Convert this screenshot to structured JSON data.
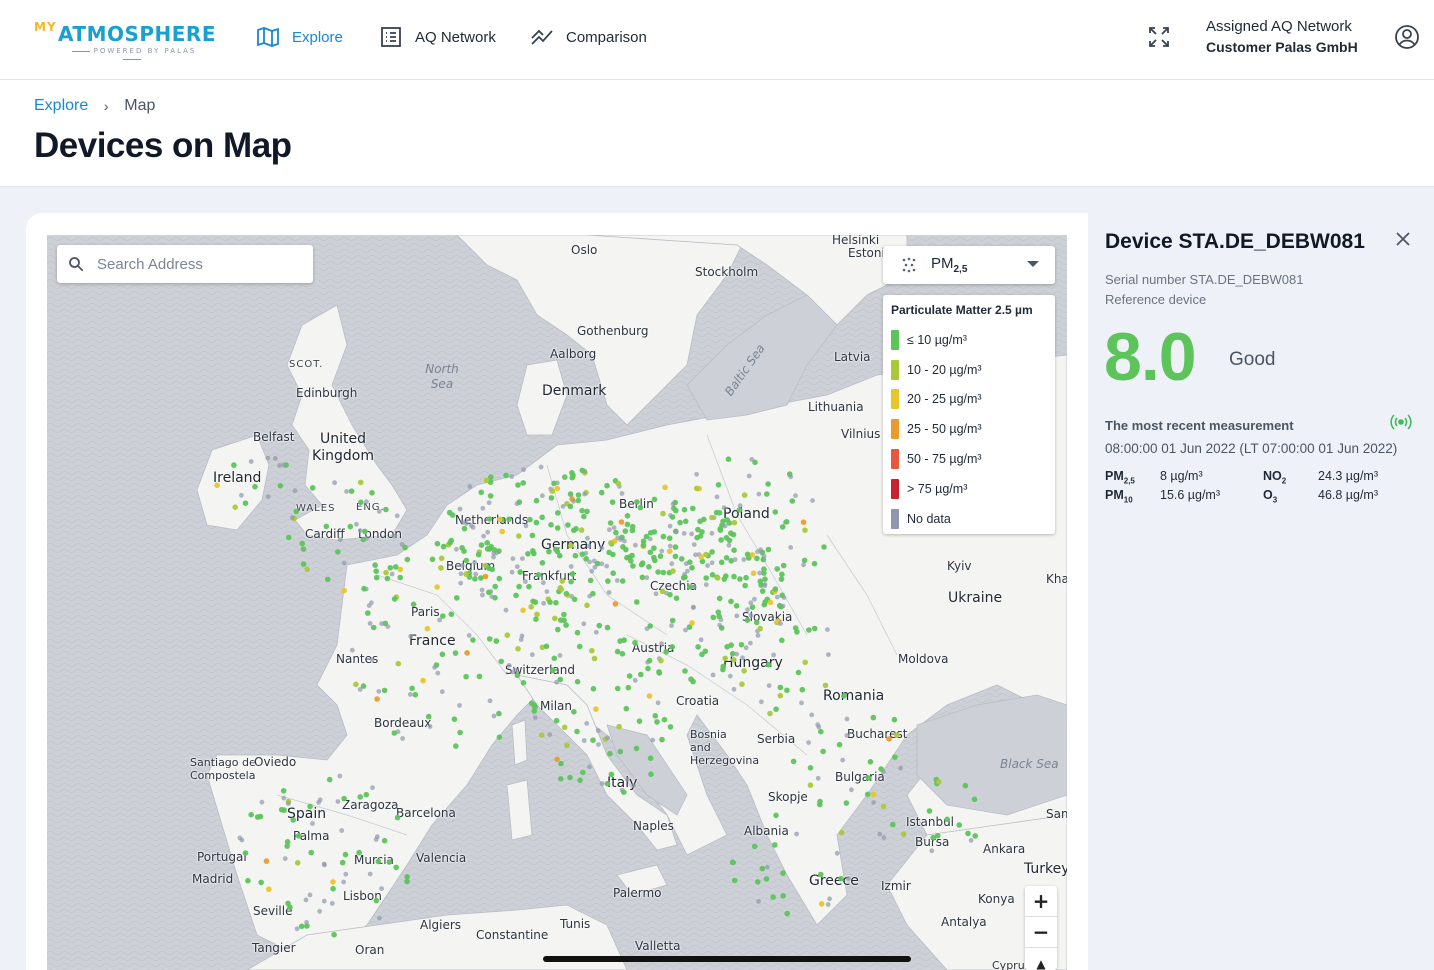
{
  "header": {
    "logo": {
      "my": "MY",
      "main": "ATMOSPHERE",
      "tagline": "POWERED BY PALAS"
    },
    "nav": [
      {
        "label": "Explore",
        "icon": "map-icon",
        "active": true
      },
      {
        "label": "AQ Network",
        "icon": "list-icon",
        "active": false
      },
      {
        "label": "Comparison",
        "icon": "chart-line-icon",
        "active": false
      }
    ],
    "network": {
      "line1": "Assigned AQ Network",
      "line2": "Customer Palas GmbH"
    },
    "icons": {
      "fullscreen": "fullscreen-icon",
      "account": "account-icon"
    }
  },
  "breadcrumb": {
    "parent": "Explore",
    "current": "Map"
  },
  "page_title": "Devices on Map",
  "map": {
    "search_placeholder": "Search Address",
    "pollutant_select": {
      "value_main": "PM",
      "value_sub": "2,5"
    },
    "legend": {
      "title": "Particulate Matter 2.5 µm",
      "items": [
        {
          "label": "≤ 10 µg/m³",
          "color": "#5cc45b"
        },
        {
          "label": "10 - 20 µg/m³",
          "color": "#a9c93b"
        },
        {
          "label": "20 - 25 µg/m³",
          "color": "#e9c52a"
        },
        {
          "label": "25 - 50 µg/m³",
          "color": "#ec9a2d"
        },
        {
          "label": "50 - 75 µg/m³",
          "color": "#e6573b"
        },
        {
          "label": "> 75 µg/m³",
          "color": "#c8232d"
        },
        {
          "label": "No data",
          "color": "#8e98ad"
        }
      ]
    },
    "zoom": {
      "in": "+",
      "out": "−",
      "compass": "▲"
    },
    "labels": {
      "seas": [
        "North Sea",
        "Baltic Sea",
        "Black Sea"
      ],
      "countries": [
        "Ireland",
        "United Kingdom",
        "Denmark",
        "Germany",
        "Poland",
        "Czechia",
        "Ukraine",
        "France",
        "Austria",
        "Hungary",
        "Switzerland",
        "Romania",
        "Moldova",
        "Croatia",
        "Serbia",
        "Bosnia and Herzegovina",
        "Bulgaria",
        "Italy",
        "Spain",
        "Portugal",
        "Greece",
        "Albania",
        "Turkey",
        "Lithuania",
        "Latvia",
        "Estonia",
        "Slovakia"
      ],
      "regions": [
        "SCOT.",
        "WALES",
        "ENG."
      ],
      "cities": [
        "Oslo",
        "Helsinki",
        "Stockholm",
        "Gothenburg",
        "Aalborg",
        "Edinburgh",
        "Belfast",
        "Cardiff",
        "London",
        "Netherlands",
        "Berlin",
        "Belgium",
        "Frankfurt",
        "Paris",
        "Nantes",
        "Bordeaux",
        "Milan",
        "Kyiv",
        "Vilnius",
        "Bucharest",
        "Skopje",
        "Naples",
        "Palermo",
        "Valletta",
        "Tunis",
        "Algiers",
        "Oran",
        "Constantine",
        "Tangier",
        "Seville",
        "Lisbon",
        "Madrid",
        "Valencia",
        "Palma",
        "Murcia",
        "Barcelona",
        "Zaragoza",
        "Oviedo",
        "Santiago de Compostela",
        "Istanbul",
        "Bursa",
        "Ankara",
        "Izmir",
        "Konya",
        "Antalya",
        "Cyprus",
        "Kha",
        "Sam"
      ]
    }
  },
  "device": {
    "title": "Device STA.DE_DEBW081",
    "serial": "Serial number STA.DE_DEBW081",
    "type": "Reference device",
    "value": "8.0",
    "quality": "Good",
    "value_color": "#5cc45b",
    "measurement_label": "The most recent measurement",
    "timestamp": "08:00:00 01 Jun 2022 (LT 07:00:00 01 Jun 2022)",
    "readings": [
      {
        "key": "PM",
        "sub": "2,5",
        "value": "8 µg/m³"
      },
      {
        "key": "NO",
        "sub": "2",
        "value": "24.3 µg/m³"
      },
      {
        "key": "PM",
        "sub": "10",
        "value": "15.6 µg/m³"
      },
      {
        "key": "O",
        "sub": "3",
        "value": "46.8 µg/m³"
      }
    ]
  }
}
